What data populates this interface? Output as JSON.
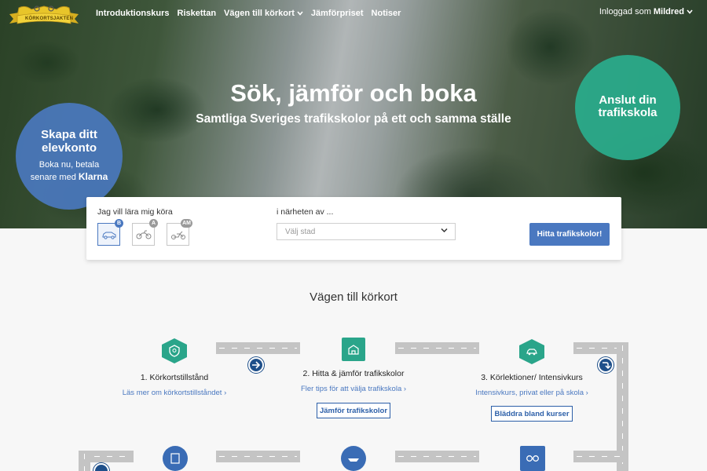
{
  "nav": {
    "logo_text": "KÖRKORTSJAKTEN",
    "links": [
      "Introduktionskurs",
      "Riskettan",
      "Vägen till körkort",
      "Jämförpriset",
      "Notiser"
    ],
    "user_prefix": "Inloggad som",
    "user_name": "Mildred"
  },
  "hero": {
    "title": "Sök, jämför och boka",
    "subtitle": "Samtliga Sveriges trafikskolor på ett och samma ställe",
    "left_circle": {
      "title": "Skapa ditt elevkonto",
      "line1": "Boka nu, betala",
      "line2": "senare med",
      "brand": "Klarna"
    },
    "right_circle": {
      "title": "Anslut din trafikskola"
    }
  },
  "search": {
    "vehicle_label": "Jag vill lära mig köra",
    "vehicles": [
      {
        "badge": "B",
        "icon": "car-icon",
        "active": true
      },
      {
        "badge": "A",
        "icon": "motorcycle-icon",
        "active": false
      },
      {
        "badge": "AM",
        "icon": "moped-icon",
        "active": false
      }
    ],
    "location_label": "i närheten av ...",
    "city_placeholder": "Välj stad",
    "button": "Hitta trafikskolor!"
  },
  "roadmap": {
    "title": "Vägen till körkort",
    "steps": [
      {
        "title": "1. Körkortstillstånd",
        "link": "Läs mer om körkortstillståndet",
        "button": ""
      },
      {
        "title": "2. Hitta & jämför trafikskolor",
        "link": "Fler tips för att välja trafikskola",
        "button": "Jämför trafikskolor"
      },
      {
        "title": "3. Körlektioner/ Intensivkurs",
        "link": "Intensivkurs, privat eller på skola",
        "button": "Bläddra bland kurser"
      }
    ]
  },
  "colors": {
    "primary": "#4a78c0",
    "teal": "#2aa58a",
    "dark_blue": "#1e4f8a"
  }
}
